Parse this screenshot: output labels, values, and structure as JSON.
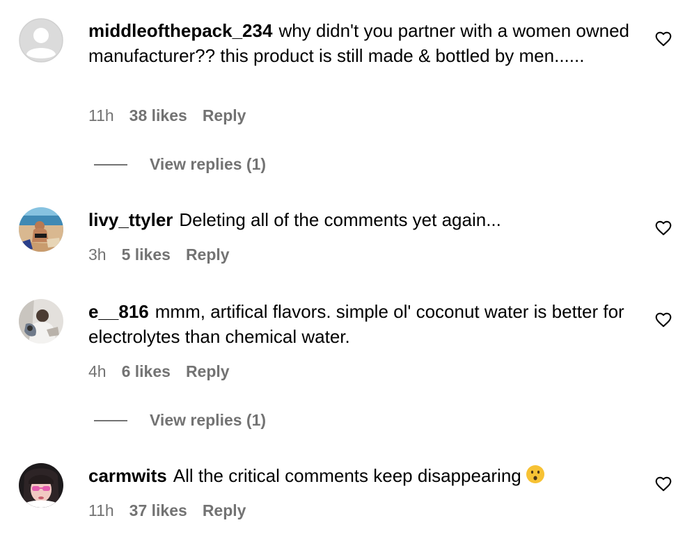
{
  "comments": [
    {
      "username": "middleofthepack_234",
      "text": "why didn't you partner with a women owned manufacturer?? this product is still made & bottled by men......",
      "time": "11h",
      "likes": "38 likes",
      "reply": "Reply",
      "view_replies": "View replies (1)",
      "avatar_icon": "default-avatar-icon"
    },
    {
      "username": "livy_ttyler",
      "text": "Deleting all of the comments yet again...",
      "time": "3h",
      "likes": "5 likes",
      "reply": "Reply",
      "avatar_icon": "beach-photo-avatar"
    },
    {
      "username": "e__816",
      "text": "mmm, artifical flavors. simple ol' coconut water is better for electrolytes than chemical water.",
      "time": "4h",
      "likes": "6 likes",
      "reply": "Reply",
      "view_replies": "View replies (1)",
      "avatar_icon": "photo-avatar"
    },
    {
      "username": "carmwits",
      "text": "All the critical comments keep disappearing",
      "emoji": "hushed-face-emoji",
      "time": "11h",
      "likes": "37 likes",
      "reply": "Reply",
      "avatar_icon": "photo-avatar"
    }
  ],
  "icons": {
    "like": "heart-outline-icon"
  },
  "colors": {
    "text": "#000000",
    "secondary_text": "#737373",
    "default_avatar_bg": "#dbdbdb",
    "emoji_yellow": "#f7c234"
  }
}
